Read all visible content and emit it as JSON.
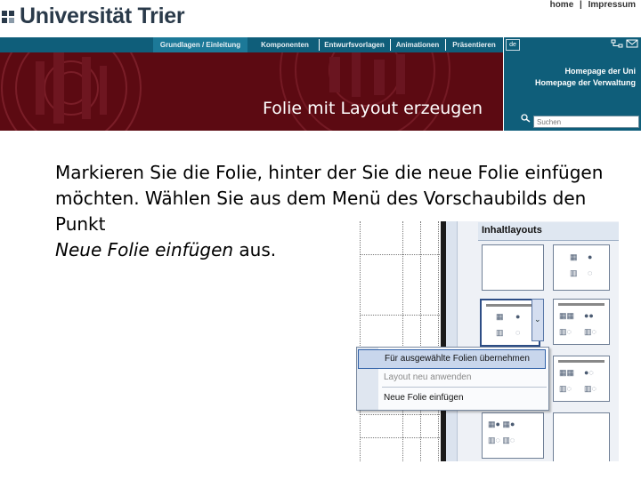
{
  "header": {
    "logo_text": "Universität Trier",
    "toplinks": [
      "home",
      "Impressum"
    ],
    "toplink_separator": "|"
  },
  "nav": {
    "items": [
      "Grundlagen / Einleitung",
      "Komponenten",
      "Entwurfsvorlagen",
      "Animationen",
      "Präsentieren"
    ]
  },
  "banner": {
    "title": "Folie mit Layout erzeugen"
  },
  "right_panel": {
    "lang": "de",
    "link_uni": "Homepage der Uni",
    "link_verwaltung": "Homepage der Verwaltung",
    "search_placeholder": "Suchen",
    "icons": [
      "sitemap-icon",
      "mail-icon",
      "search-icon"
    ]
  },
  "content": {
    "line1": "Markieren Sie die Folie, hinter der Sie die neue Folie einfügen",
    "line2": "möchten. Wählen Sie aus dem Menü des Vorschaubilds den",
    "line3": "Punkt",
    "line4_italic": "Neue Folie einfügen",
    "line4_rest": " aus."
  },
  "inset": {
    "panel_title": "Inhaltlayouts",
    "menu_items": [
      "Für ausgewählte Folien übernehmen",
      "Layout neu anwenden",
      "Neue Folie einfügen"
    ],
    "arrow": "⌄"
  },
  "colors": {
    "nav_bg": "#0f5e7a",
    "nav_active": "#1c7998",
    "banner_bg": "#5c0a12",
    "logo_text": "#2a3a4a"
  }
}
